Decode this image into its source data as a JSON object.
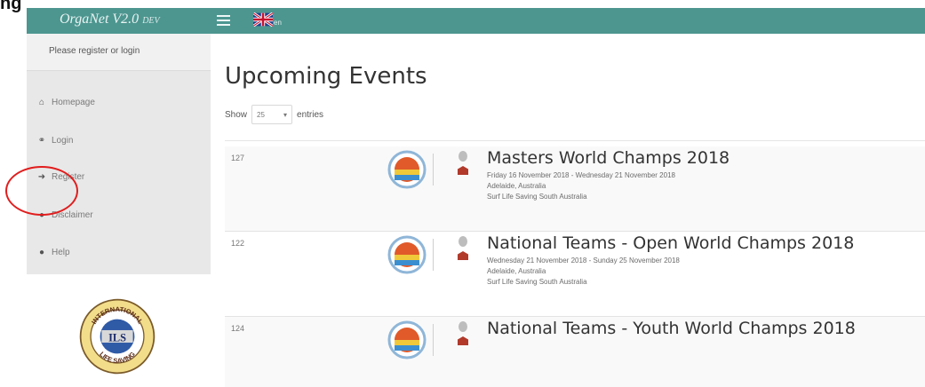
{
  "header": {
    "corner_fragment": "ng",
    "brand": "OrgaNet V2.0",
    "brand_suffix": "DEV",
    "lang_code": "en"
  },
  "sidebar": {
    "login_message": "Please register or login",
    "items": [
      {
        "label": "Homepage",
        "icon": "home-icon"
      },
      {
        "label": "Login",
        "icon": "key-icon"
      },
      {
        "label": "Register",
        "icon": "sign-in-icon"
      },
      {
        "label": "Disclaimer",
        "icon": "exclamation-circle-icon"
      },
      {
        "label": "Help",
        "icon": "question-circle-icon"
      }
    ],
    "logo": {
      "top_text": "INTERNATIONAL",
      "center_text": "ILS",
      "bottom_text": "LIFE SAVING"
    }
  },
  "main": {
    "title": "Upcoming Events",
    "length": {
      "show_label": "Show",
      "value": "25",
      "entries_label": "entries"
    },
    "events": [
      {
        "id": "127",
        "name": "Masters World Champs 2018",
        "dates": "Friday 16 November 2018 - Wednesday 21 November 2018",
        "location": "Adelaide, Australia",
        "organiser": "Surf Life Saving South Australia"
      },
      {
        "id": "122",
        "name": "National Teams - Open World Champs 2018",
        "dates": "Wednesday 21 November 2018 - Sunday 25 November 2018",
        "location": "Adelaide, Australia",
        "organiser": "Surf Life Saving South Australia"
      },
      {
        "id": "124",
        "name": "National Teams - Youth World Champs 2018",
        "dates": "",
        "location": "",
        "organiser": ""
      }
    ]
  },
  "colors": {
    "navbar": "#4d9690",
    "sidebar": "#e8e8e8",
    "annotation": "#e11d1d"
  }
}
